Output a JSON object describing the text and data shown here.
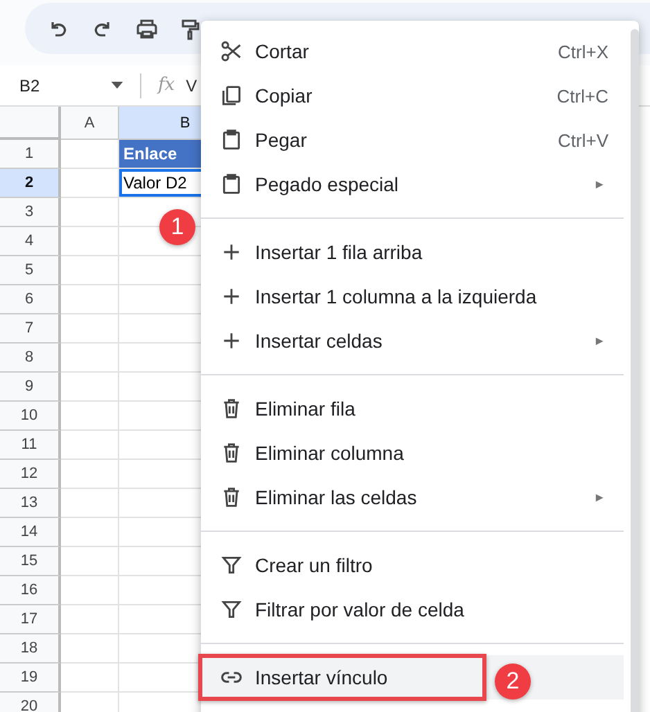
{
  "name_box": {
    "value": "B2"
  },
  "formula_bar": {
    "label": "fx",
    "value": "V"
  },
  "columns": [
    "A",
    "B"
  ],
  "rows": [
    {
      "number": "1",
      "selected": false,
      "cell_b": "Enlace",
      "kind": "header"
    },
    {
      "number": "2",
      "selected": true,
      "cell_b": "Valor D2",
      "kind": "value"
    },
    {
      "number": "3",
      "selected": false
    },
    {
      "number": "4",
      "selected": false
    },
    {
      "number": "5",
      "selected": false
    },
    {
      "number": "6",
      "selected": false
    },
    {
      "number": "7",
      "selected": false
    },
    {
      "number": "8",
      "selected": false
    },
    {
      "number": "9",
      "selected": false
    },
    {
      "number": "10",
      "selected": false
    },
    {
      "number": "11",
      "selected": false
    },
    {
      "number": "12",
      "selected": false
    },
    {
      "number": "13",
      "selected": false
    },
    {
      "number": "14",
      "selected": false
    },
    {
      "number": "15",
      "selected": false
    },
    {
      "number": "16",
      "selected": false
    },
    {
      "number": "17",
      "selected": false
    },
    {
      "number": "18",
      "selected": false
    },
    {
      "number": "19",
      "selected": false
    },
    {
      "number": "20",
      "selected": false
    }
  ],
  "context_menu": [
    {
      "kind": "item",
      "label": "Cortar",
      "shortcut": "Ctrl+X",
      "selected": false
    },
    {
      "kind": "item",
      "label": "Copiar",
      "shortcut": "Ctrl+C",
      "selected": false
    },
    {
      "kind": "item",
      "label": "Pegar",
      "shortcut": "Ctrl+V",
      "selected": false
    },
    {
      "kind": "item",
      "label": "Pegado especial",
      "submenu": "►",
      "selected": false
    },
    {
      "kind": "divider"
    },
    {
      "kind": "item",
      "label": "Insertar 1 fila arriba",
      "selected": false
    },
    {
      "kind": "item",
      "label": "Insertar 1 columna a la izquierda",
      "selected": false
    },
    {
      "kind": "item",
      "label": "Insertar celdas",
      "submenu": "►",
      "selected": false
    },
    {
      "kind": "divider"
    },
    {
      "kind": "item",
      "label": "Eliminar fila",
      "selected": false
    },
    {
      "kind": "item",
      "label": "Eliminar columna",
      "selected": false
    },
    {
      "kind": "item",
      "label": "Eliminar las celdas",
      "submenu": "►",
      "selected": false
    },
    {
      "kind": "divider"
    },
    {
      "kind": "item",
      "label": "Crear un filtro",
      "selected": false
    },
    {
      "kind": "item",
      "label": "Filtrar por valor de celda",
      "selected": false
    },
    {
      "kind": "divider"
    },
    {
      "kind": "item",
      "label": "Insertar vínculo",
      "selected": true,
      "outlined": true
    }
  ],
  "callouts": [
    "1",
    "2"
  ]
}
